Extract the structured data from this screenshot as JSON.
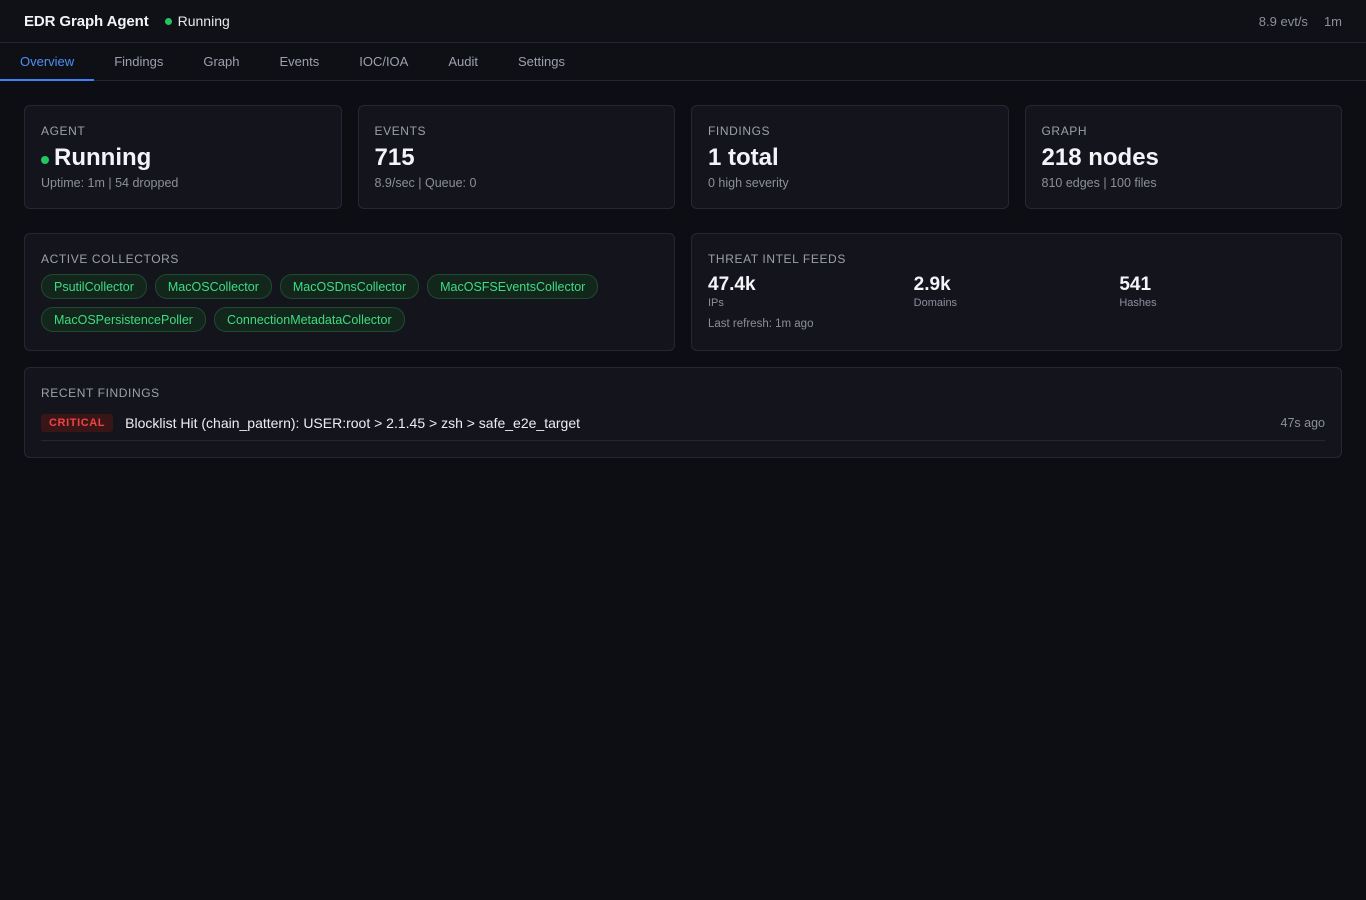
{
  "header": {
    "title": "EDR Graph Agent",
    "status": "Running",
    "rate": "8.9 evt/s",
    "uptime": "1m",
    "status_color": "#22c55e"
  },
  "tabs": [
    {
      "label": "Overview",
      "active": true
    },
    {
      "label": "Findings"
    },
    {
      "label": "Graph"
    },
    {
      "label": "Events"
    },
    {
      "label": "IOC/IOA"
    },
    {
      "label": "Audit"
    },
    {
      "label": "Settings"
    }
  ],
  "stats": {
    "agent": {
      "label": "AGENT",
      "value": "Running",
      "sub": "Uptime: 1m | 54 dropped"
    },
    "events": {
      "label": "EVENTS",
      "value": "715",
      "sub": "8.9/sec | Queue: 0"
    },
    "findings": {
      "label": "FINDINGS",
      "value": "1 total",
      "sub": "0 high severity"
    },
    "graph": {
      "label": "GRAPH",
      "value": "218 nodes",
      "sub": "810 edges | 100 files"
    }
  },
  "collectors": {
    "label": "ACTIVE COLLECTORS",
    "items": [
      "PsutilCollector",
      "MacOSCollector",
      "MacOSDnsCollector",
      "MacOSFSEventsCollector",
      "MacOSPersistencePoller",
      "ConnectionMetadataCollector"
    ]
  },
  "threat_intel": {
    "label": "THREAT INTEL FEEDS",
    "feeds": [
      {
        "value": "47.4k",
        "label": "IPs"
      },
      {
        "value": "2.9k",
        "label": "Domains"
      },
      {
        "value": "541",
        "label": "Hashes"
      }
    ],
    "refresh": "Last refresh: 1m ago"
  },
  "recent_findings": {
    "label": "RECENT FINDINGS",
    "items": [
      {
        "severity": "CRITICAL",
        "title": "Blocklist Hit (chain_pattern): USER:root > 2.1.45 > zsh > safe_e2e_target",
        "time": "47s ago"
      }
    ]
  },
  "colors": {
    "accent": "#3b82f6",
    "success": "#22c55e",
    "critical": "#ef4444"
  }
}
